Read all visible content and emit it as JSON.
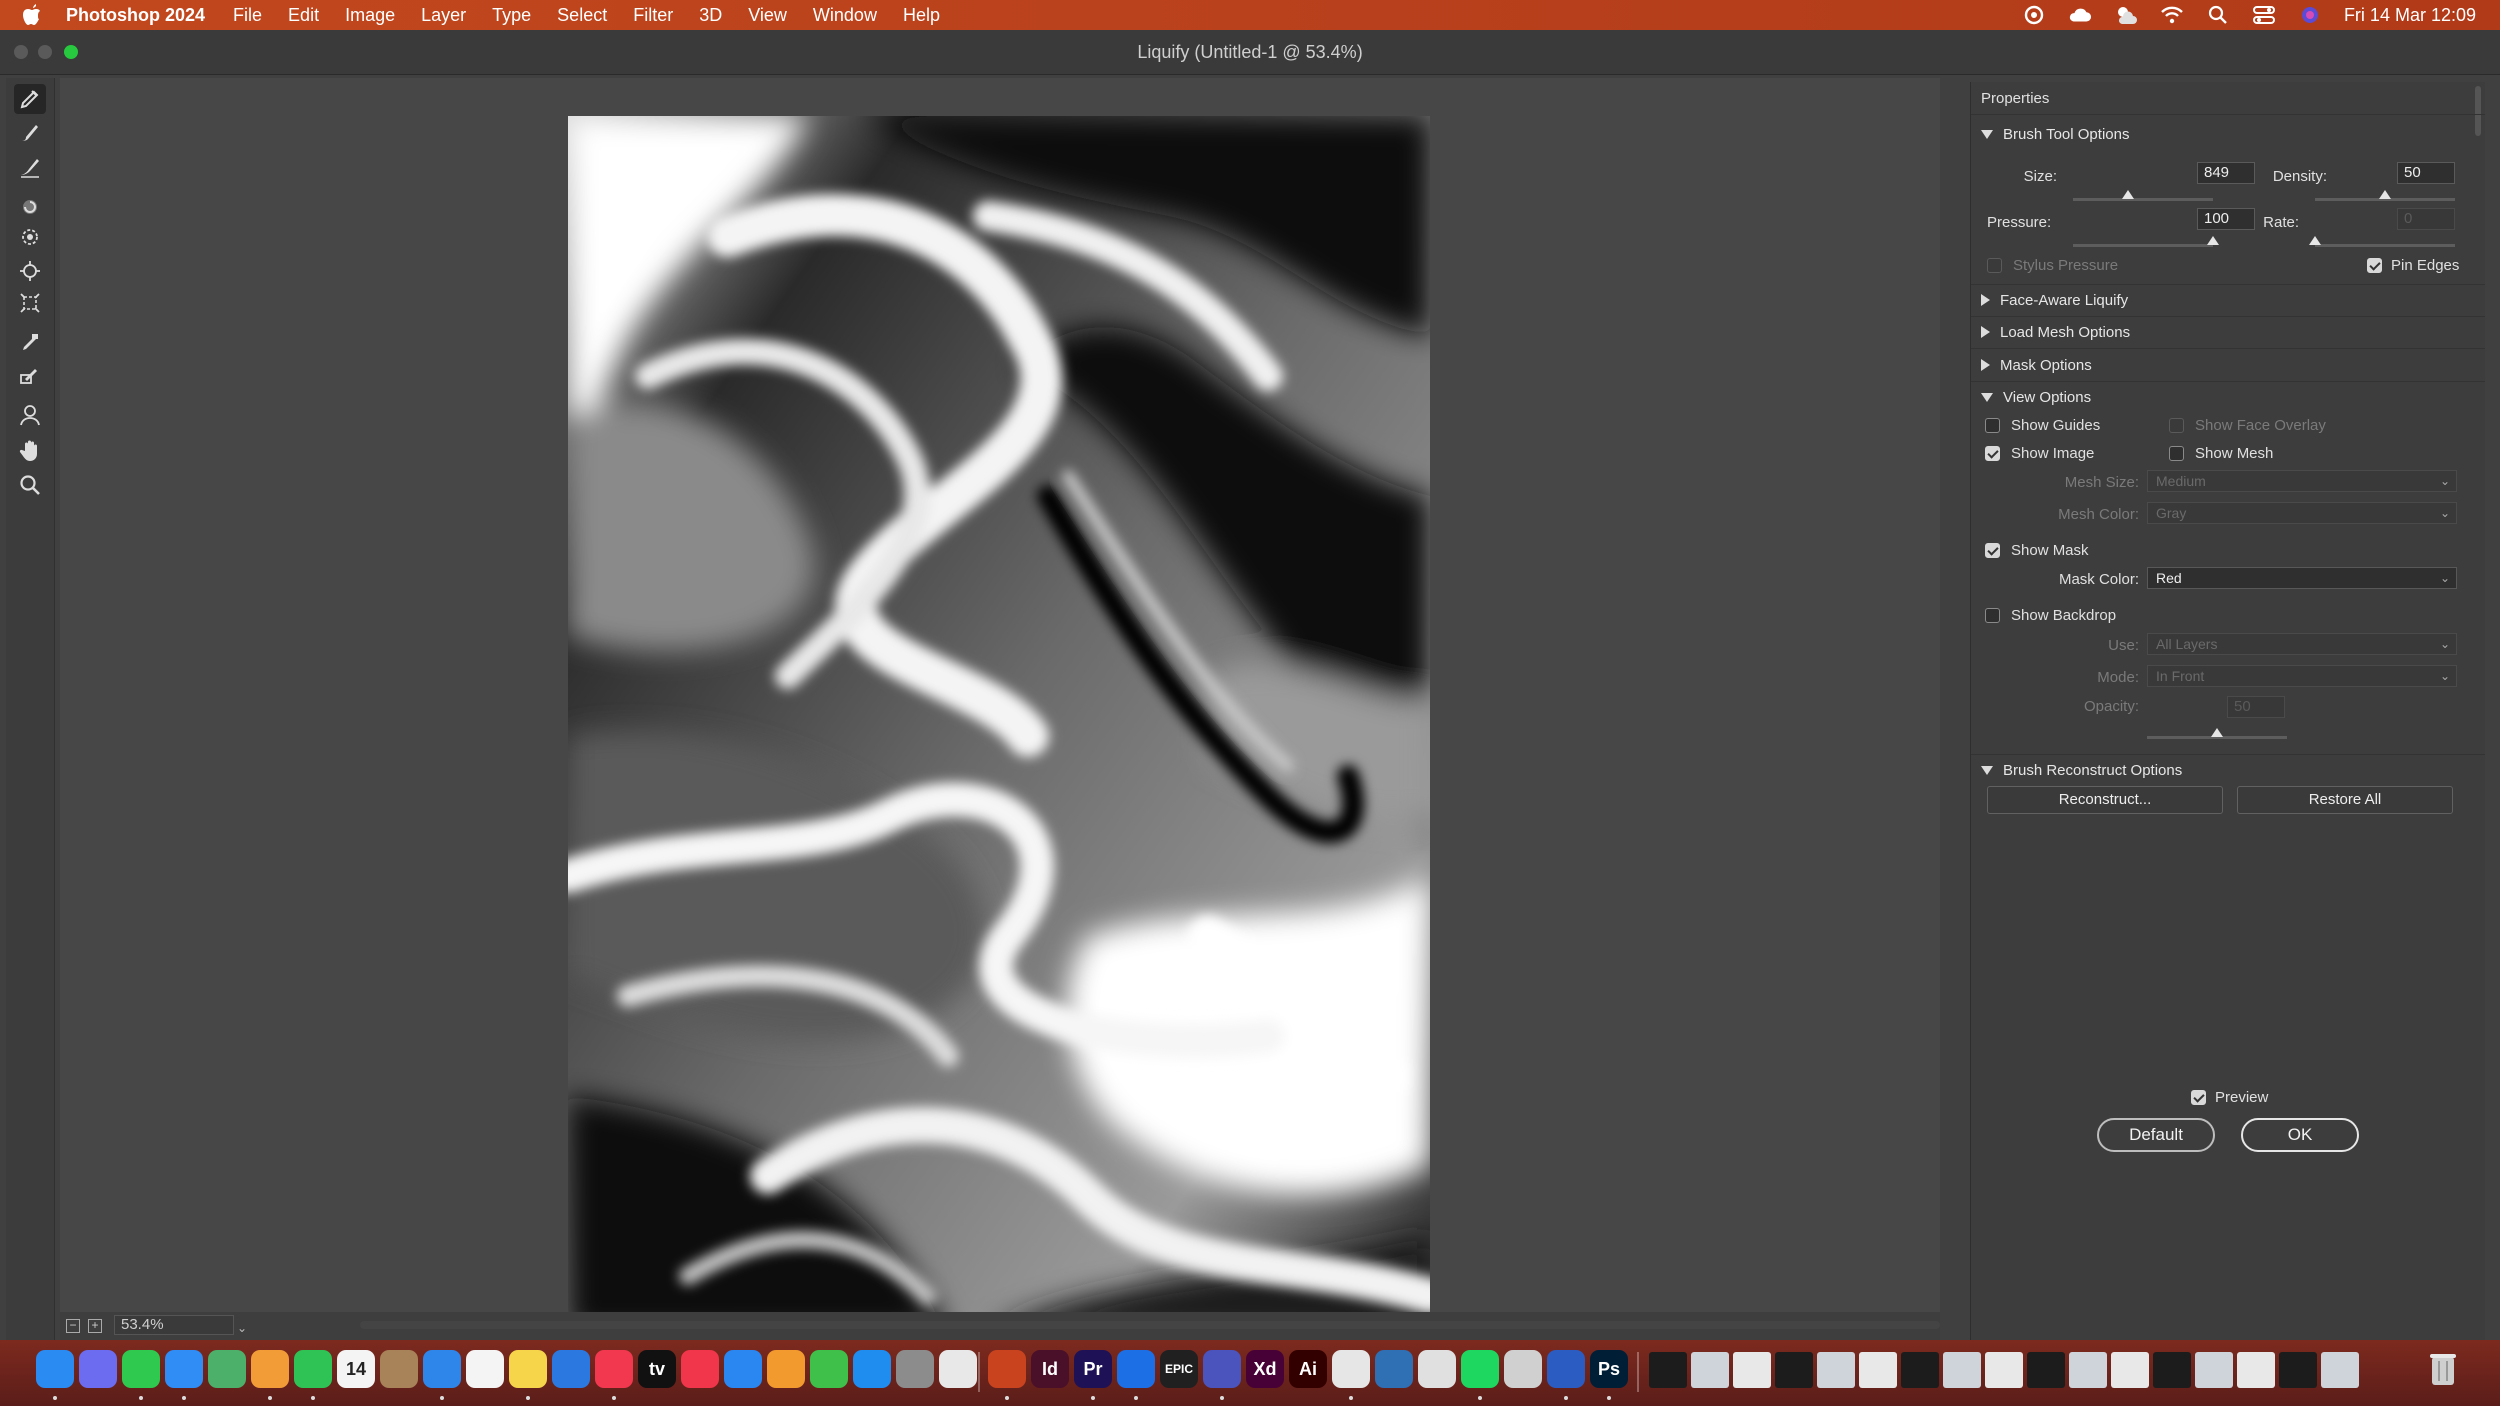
{
  "menubar": {
    "app_name": "Photoshop 2024",
    "items": [
      "File",
      "Edit",
      "Image",
      "Layer",
      "Type",
      "Select",
      "Filter",
      "3D",
      "View",
      "Window",
      "Help"
    ],
    "datetime": "Fri 14 Mar  12:09",
    "status_icons": [
      "creative-cloud-icon",
      "icloud-icon",
      "weather-icon",
      "wifi-icon",
      "spotlight-icon",
      "control-center-icon",
      "siri-icon"
    ]
  },
  "window": {
    "title": "Liquify (Untitled-1 @ 53.4%)"
  },
  "tools": [
    "forward-warp-tool-icon",
    "reconstruct-tool-icon",
    "smooth-tool-icon",
    "twirl-clockwise-tool-icon",
    "pucker-tool-icon",
    "bloat-tool-icon",
    "push-left-tool-icon",
    "freeze-mask-tool-icon",
    "thaw-mask-tool-icon",
    "face-tool-icon",
    "hand-tool-icon",
    "zoom-tool-icon"
  ],
  "status": {
    "zoom": "53.4%"
  },
  "properties": {
    "title": "Properties",
    "brush_tool_options": {
      "header": "Brush Tool Options",
      "size_label": "Size:",
      "size_value": "849",
      "size_level": 0.39,
      "density_label": "Density:",
      "density_value": "50",
      "density_level": 0.5,
      "pressure_label": "Pressure:",
      "pressure_value": "100",
      "pressure_level": 1.0,
      "rate_label": "Rate:",
      "rate_value": "0",
      "rate_level": 0.0,
      "stylus_pressure": "Stylus Pressure",
      "pin_edges": "Pin Edges"
    },
    "collapsed_sections": [
      "Face-Aware Liquify",
      "Load Mesh Options",
      "Mask Options"
    ],
    "view_options": {
      "header": "View Options",
      "show_guides": "Show Guides",
      "show_face_overlay": "Show Face Overlay",
      "show_image": "Show Image",
      "show_mesh": "Show Mesh",
      "mesh_size_label": "Mesh Size:",
      "mesh_size_value": "Medium",
      "mesh_color_label": "Mesh Color:",
      "mesh_color_value": "Gray",
      "show_mask": "Show Mask",
      "mask_color_label": "Mask Color:",
      "mask_color_value": "Red",
      "show_backdrop": "Show Backdrop",
      "use_label": "Use:",
      "use_value": "All Layers",
      "mode_label": "Mode:",
      "mode_value": "In Front",
      "opacity_label": "Opacity:",
      "opacity_value": "50",
      "opacity_level": 0.5
    },
    "reconstruct": {
      "header": "Brush Reconstruct Options",
      "reconstruct_button": "Reconstruct...",
      "restore_all_button": "Restore All"
    },
    "preview": "Preview",
    "default_button": "Default",
    "ok_button": "OK"
  },
  "dock": {
    "calendar_day": "14",
    "apps": [
      {
        "name": "finder",
        "color": "#2a8bf2",
        "label": ""
      },
      {
        "name": "launchpad",
        "color": "#6c6cf0",
        "label": ""
      },
      {
        "name": "messages",
        "color": "#30c94f",
        "label": ""
      },
      {
        "name": "mail",
        "color": "#2f8df5",
        "label": ""
      },
      {
        "name": "maps",
        "color": "#4caf6a",
        "label": ""
      },
      {
        "name": "photos",
        "color": "#f29c38",
        "label": ""
      },
      {
        "name": "facetime",
        "color": "#2fc356",
        "label": ""
      },
      {
        "name": "calendar",
        "color": "#f4f4f4",
        "label": ""
      },
      {
        "name": "contacts",
        "color": "#a88258",
        "label": ""
      },
      {
        "name": "safari",
        "color": "#2f86ea",
        "label": ""
      },
      {
        "name": "reminders",
        "color": "#f4f4f4",
        "label": ""
      },
      {
        "name": "notes",
        "color": "#f7d54a",
        "label": ""
      },
      {
        "name": "freeform",
        "color": "#2b79e0",
        "label": ""
      },
      {
        "name": "music",
        "color": "#f2384f",
        "label": ""
      },
      {
        "name": "apple-tv",
        "color": "#111111",
        "label": "tv"
      },
      {
        "name": "news",
        "color": "#f1354a",
        "label": ""
      },
      {
        "name": "keynote",
        "color": "#2a86f0",
        "label": ""
      },
      {
        "name": "pages",
        "color": "#f29a2e",
        "label": ""
      },
      {
        "name": "numbers",
        "color": "#3ec04b",
        "label": ""
      },
      {
        "name": "app-store",
        "color": "#1f8df0",
        "label": ""
      },
      {
        "name": "system-settings",
        "color": "#8c8c8c",
        "label": ""
      },
      {
        "name": "preview-app",
        "color": "#e8e8e8",
        "label": ""
      },
      {
        "name": "powerpoint",
        "color": "#c9431e",
        "label": ""
      },
      {
        "name": "indesign",
        "color": "#4a0f29",
        "label": "Id"
      },
      {
        "name": "premiere-pro",
        "color": "#1f1155",
        "label": "Pr"
      },
      {
        "name": "xcode",
        "color": "#1d6fe6",
        "label": ""
      },
      {
        "name": "epic-games",
        "color": "#202020",
        "label": "EPIC"
      },
      {
        "name": "teams",
        "color": "#4b53bc",
        "label": ""
      },
      {
        "name": "adobe-xd",
        "color": "#470137",
        "label": "Xd"
      },
      {
        "name": "illustrator",
        "color": "#330000",
        "label": "Ai"
      },
      {
        "name": "chrome",
        "color": "#e6e6e6",
        "label": ""
      },
      {
        "name": "proxyman",
        "color": "#2f6fb3",
        "label": ""
      },
      {
        "name": "font-book",
        "color": "#e0e0e0",
        "label": ""
      },
      {
        "name": "spotify",
        "color": "#1ed760",
        "label": ""
      },
      {
        "name": "screenshot",
        "color": "#d0d0d0",
        "label": ""
      },
      {
        "name": "word",
        "color": "#2b5cc2",
        "label": ""
      },
      {
        "name": "photoshop",
        "color": "#001e36",
        "label": "Ps"
      }
    ]
  }
}
